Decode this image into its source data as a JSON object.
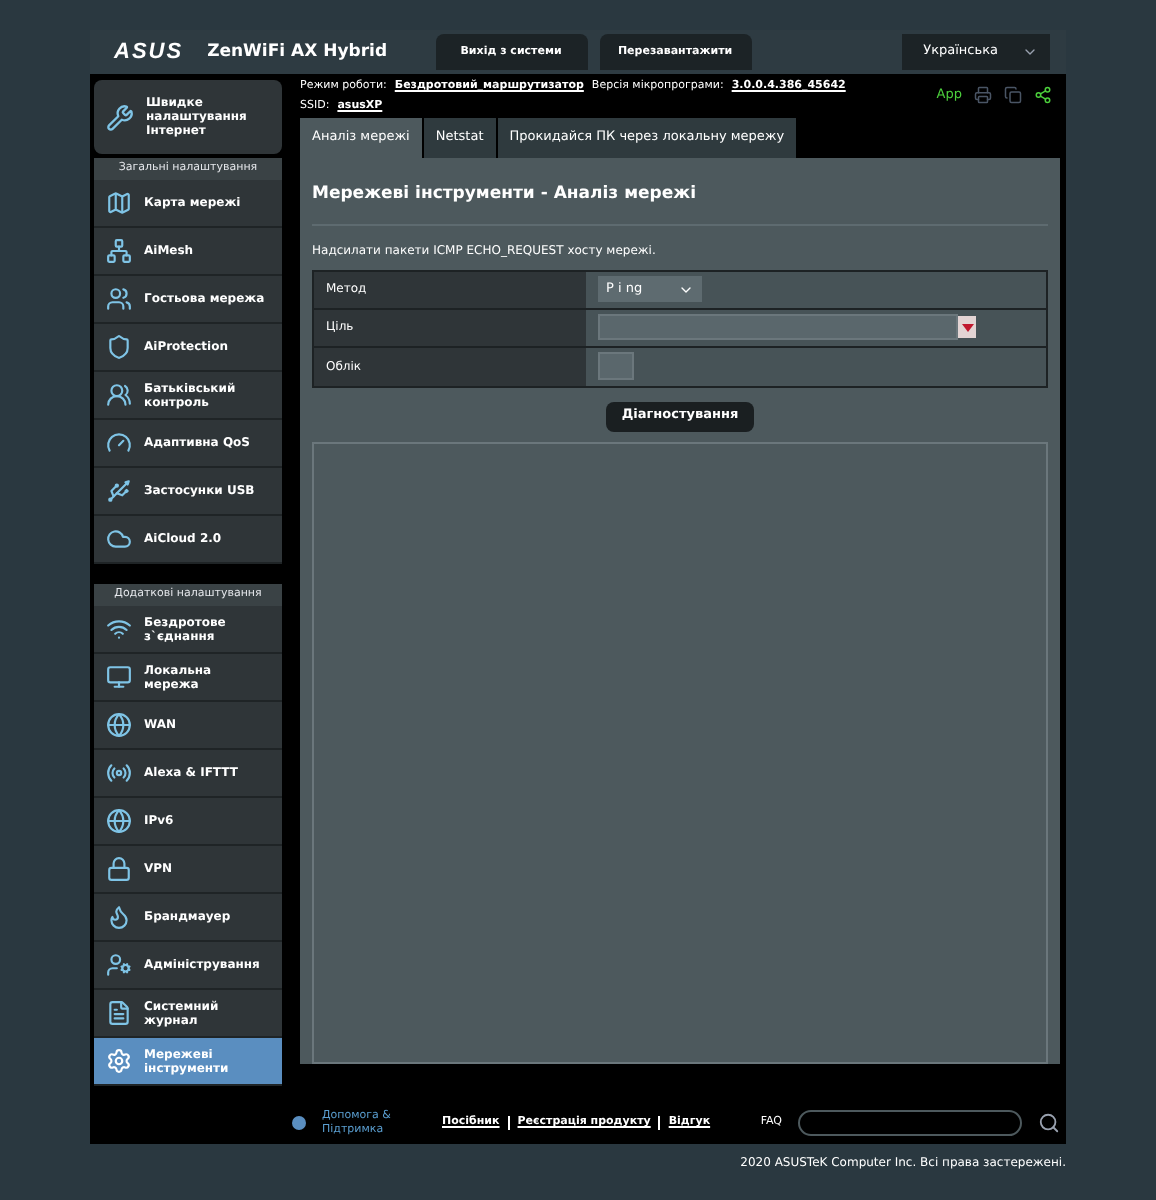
{
  "header": {
    "logo": "ASUS",
    "model": "ZenWiFi AX Hybrid",
    "buttons": [
      "Вихід з системи",
      "Перезавантажити"
    ],
    "language": "Українська"
  },
  "info": {
    "mode_label": "Режим роботи:",
    "mode_value": "Бездротовий_маршрутизатор",
    "firmware_label": "Версія мікропрограми:",
    "firmware_value": "3.0.0.4.386_45642",
    "ssid_label": "SSID:",
    "ssid_value": "asusXP",
    "app_label": "App"
  },
  "sidebar": {
    "quick_setup": "Швидке налаштування Інтернет",
    "sections": [
      {
        "title": "Загальні налаштування",
        "items": [
          {
            "label": "Карта мережі",
            "selected": false
          },
          {
            "label": "AiMesh",
            "selected": false
          },
          {
            "label": "Гостьова мережа",
            "selected": false
          },
          {
            "label": "AiProtection",
            "selected": false
          },
          {
            "label": "Батьківський контроль",
            "selected": false
          },
          {
            "label": "Адаптивна QoS",
            "selected": false
          },
          {
            "label": "Застосунки USB",
            "selected": false
          },
          {
            "label": "AiCloud 2.0",
            "selected": false
          }
        ]
      },
      {
        "title": "Додаткові налаштування",
        "items": [
          {
            "label": "Бездротове з`єднання",
            "selected": false
          },
          {
            "label": "Локальна мережа",
            "selected": false
          },
          {
            "label": "WAN",
            "selected": false
          },
          {
            "label": "Alexa & IFTTT",
            "selected": false
          },
          {
            "label": "IPv6",
            "selected": false
          },
          {
            "label": "VPN",
            "selected": false
          },
          {
            "label": "Брандмауер",
            "selected": false
          },
          {
            "label": "Адміністрування",
            "selected": false
          },
          {
            "label": "Системний журнал",
            "selected": false
          },
          {
            "label": "Мережеві інструменти",
            "selected": true
          }
        ]
      }
    ]
  },
  "tabs": [
    {
      "label": "Аналіз мережі",
      "selected": true
    },
    {
      "label": "Netstat",
      "selected": false
    },
    {
      "label": "Прокидайся ПК через локальну мережу",
      "selected": false
    }
  ],
  "content": {
    "title": "Мережеві інструменти - Аналіз мережі",
    "description": "Надсилати пакети ICMP ECHO_REQUEST хосту мережі.",
    "rows": [
      {
        "label": "Метод",
        "kind": "select",
        "value": "P i ng"
      },
      {
        "label": "Ціль",
        "kind": "combo"
      },
      {
        "label": "Облік",
        "kind": "small"
      }
    ],
    "button": "Діагностування"
  },
  "footer": {
    "help": "Допомога & Підтримка",
    "links": [
      "Посібник",
      "Реєстрація продукту",
      "Відгук"
    ],
    "faq": "FAQ"
  },
  "copyright": "2020 ASUSTeK Computer Inc. Всі права застережені."
}
